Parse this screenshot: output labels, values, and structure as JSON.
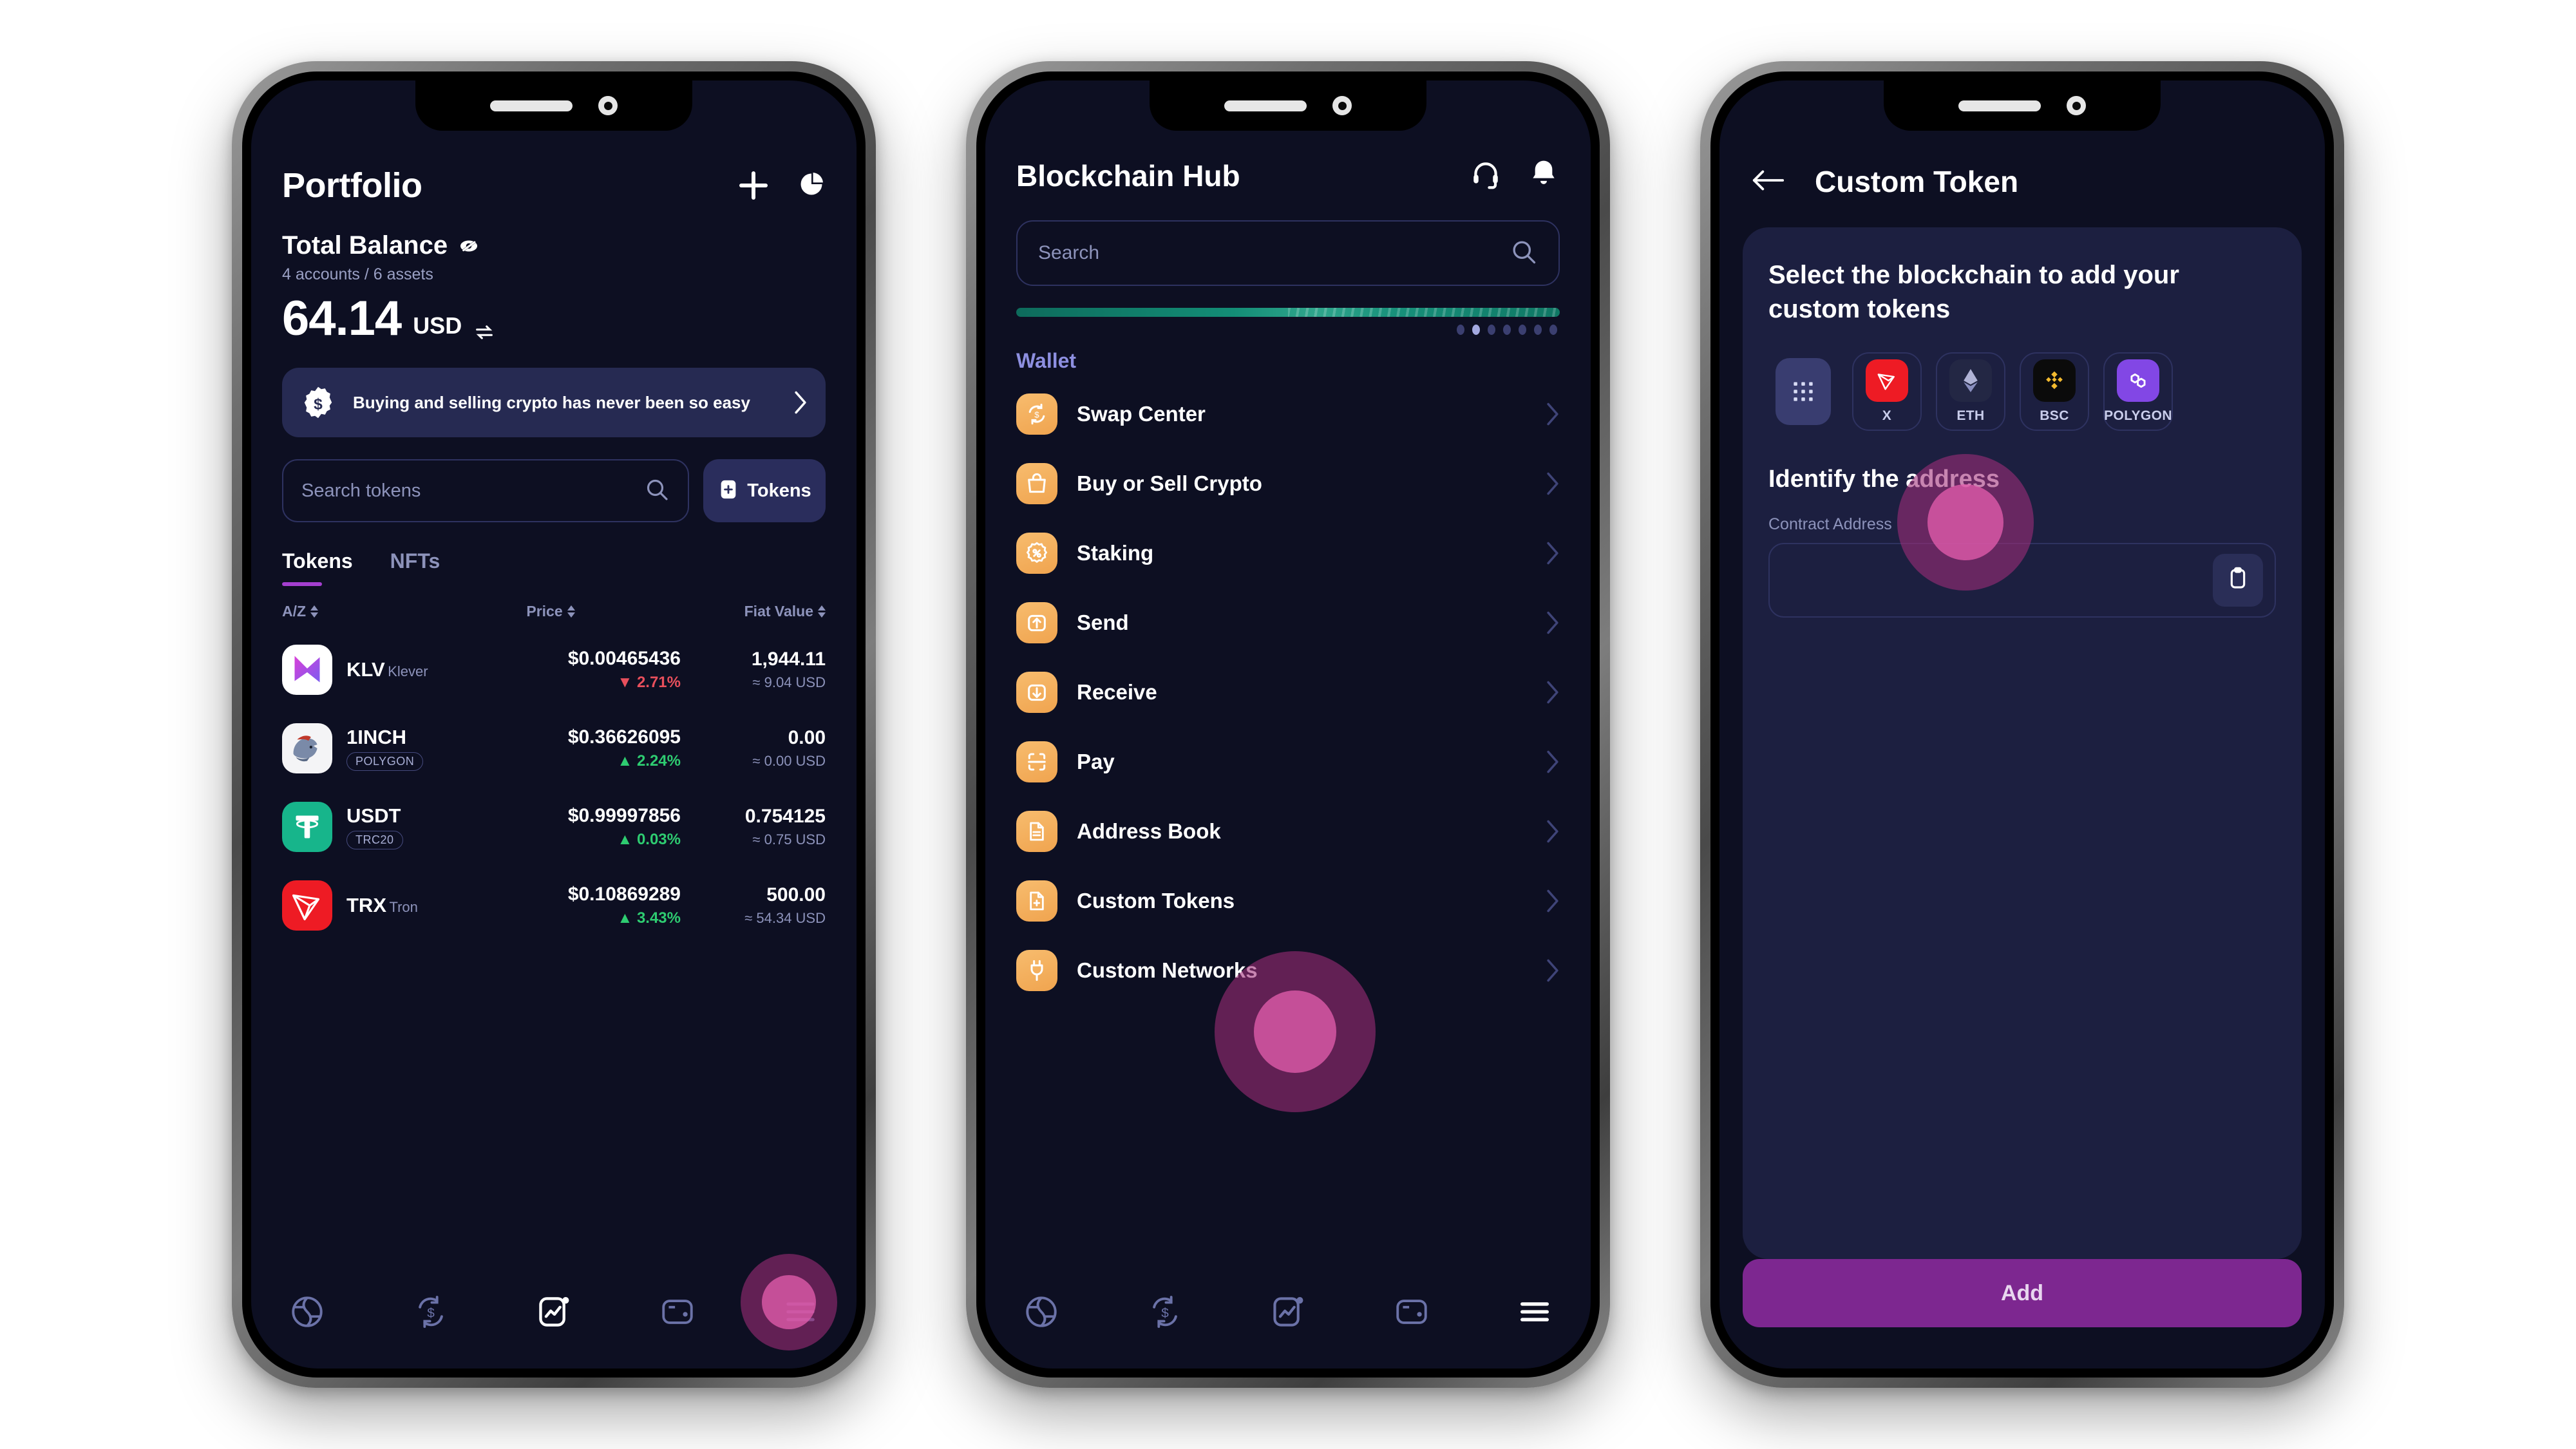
{
  "phone1": {
    "title": "Portfolio",
    "balance": {
      "label": "Total Balance",
      "accounts": "4 accounts / 6 assets",
      "amount": "64.14",
      "currency": "USD"
    },
    "promo": {
      "text": "Buying and selling crypto has never been so easy"
    },
    "search": {
      "placeholder": "Search tokens",
      "value": ""
    },
    "tokens_button": "Tokens",
    "tabs": [
      {
        "label": "Tokens",
        "active": true
      },
      {
        "label": "NFTs",
        "active": false
      }
    ],
    "columns": {
      "c1": "A/Z",
      "c2": "Price",
      "c3": "Fiat Value"
    },
    "tokens": [
      {
        "symbol": "KLV",
        "name": "Klever",
        "chip": "",
        "price": "$0.00465436",
        "change": "2.71%",
        "direction": "down",
        "amount": "1,944.11",
        "fiat": "≈ 9.04 USD",
        "logo_bg": "#ffffff",
        "logo_kind": "klever"
      },
      {
        "symbol": "1INCH",
        "name": "",
        "chip": "POLYGON",
        "price": "$0.36626095",
        "change": "2.24%",
        "direction": "up",
        "amount": "0.00",
        "fiat": "≈ 0.00 USD",
        "logo_bg": "#f4f4f6",
        "logo_kind": "unicorn"
      },
      {
        "symbol": "USDT",
        "name": "",
        "chip": "TRC20",
        "price": "$0.99997856",
        "change": "0.03%",
        "direction": "up",
        "amount": "0.754125",
        "fiat": "≈ 0.75 USD",
        "logo_bg": "#17b58b",
        "logo_kind": "tether"
      },
      {
        "symbol": "TRX",
        "name": "Tron",
        "chip": "",
        "price": "$0.10869289",
        "change": "3.43%",
        "direction": "up",
        "amount": "500.00",
        "fiat": "≈ 54.34 USD",
        "logo_bg": "#ee1b24",
        "logo_kind": "tron"
      }
    ],
    "nav": [
      {
        "name": "globe-icon",
        "active": false
      },
      {
        "name": "swap-icon",
        "active": false
      },
      {
        "name": "chart-icon",
        "active": true
      },
      {
        "name": "wallet-icon",
        "active": false
      },
      {
        "name": "menu-icon",
        "active": false
      }
    ]
  },
  "phone2": {
    "title": "Blockchain Hub",
    "search": {
      "placeholder": "Search",
      "value": ""
    },
    "carousel": {
      "dot_count": 7,
      "active_dot": 2
    },
    "section_title": "Wallet",
    "menu": [
      {
        "label": "Swap Center",
        "icon": "swap-dollar-icon"
      },
      {
        "label": "Buy or Sell Crypto",
        "icon": "bag-icon"
      },
      {
        "label": "Staking",
        "icon": "percent-badge-icon"
      },
      {
        "label": "Send",
        "icon": "upload-icon"
      },
      {
        "label": "Receive",
        "icon": "download-icon"
      },
      {
        "label": "Pay",
        "icon": "scan-icon"
      },
      {
        "label": "Address Book",
        "icon": "document-icon"
      },
      {
        "label": "Custom Tokens",
        "icon": "document-plus-icon"
      },
      {
        "label": "Custom Networks",
        "icon": "plug-icon"
      }
    ],
    "nav": [
      {
        "name": "globe-icon",
        "active": false
      },
      {
        "name": "swap-icon",
        "active": false
      },
      {
        "name": "chart-icon",
        "active": false
      },
      {
        "name": "wallet-icon",
        "active": false
      },
      {
        "name": "menu-icon",
        "active": true
      }
    ]
  },
  "phone3": {
    "title": "Custom Token",
    "card_heading": "Select the blockchain to add your custom tokens",
    "chains": [
      {
        "label": "",
        "short": "grid",
        "bg": "#393d70"
      },
      {
        "label": "X",
        "short": "tron",
        "bg": "#ee1b24"
      },
      {
        "label": "ETH",
        "short": "eth",
        "bg": "#e05fa8"
      },
      {
        "label": "BSC",
        "short": "bsc",
        "bg": "#0b0b0b"
      },
      {
        "label": "POLYGON",
        "short": "polygon",
        "bg": "#8247e5"
      }
    ],
    "section_heading": "Identify the address",
    "field_label": "Contract Address",
    "field_value": "",
    "paste_icon": "clipboard-icon",
    "add_button": "Add"
  },
  "colors": {
    "screen_bg": "#0d0f22",
    "card_bg": "#1c1f40",
    "accent_purple": "#a43fd0",
    "add_button": "#7d2790",
    "up_green": "#2ecc71",
    "down_red": "#e84f5c",
    "muted": "#8d93bb",
    "orange_icon": "#f0a44f"
  }
}
